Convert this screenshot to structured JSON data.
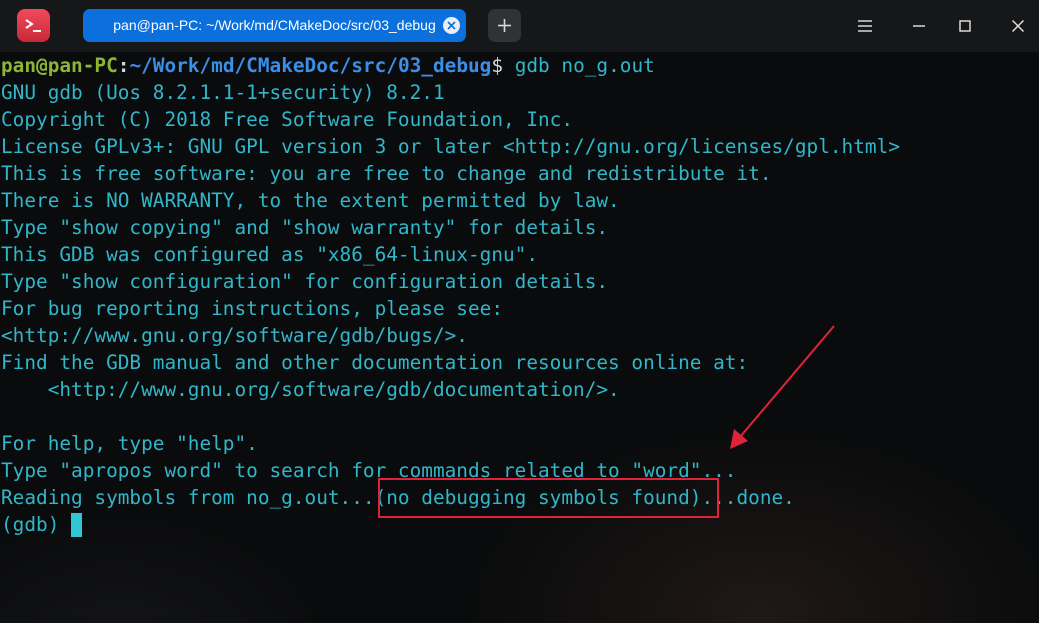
{
  "window": {
    "tab_title": "pan@pan-PC: ~/Work/md/CMakeDoc/src/03_debug",
    "icons": {
      "app": "terminal-app-icon",
      "tab_close": "close-icon",
      "new_tab": "plus-icon",
      "menu": "hamburger-menu-icon",
      "minimize": "minimize-icon",
      "maximize": "maximize-icon",
      "close": "close-icon"
    },
    "colors": {
      "tab_active": "#0b6fdc",
      "app_icon": "#e33b4c",
      "highlight": "#e0233a"
    }
  },
  "terminal": {
    "prompt": {
      "user_host": "pan@pan-PC",
      "separator": ":",
      "path": "~/Work/md/CMakeDoc/src/03_debug",
      "dollar": "$",
      "command": " gdb no_g.out"
    },
    "lines": [
      "GNU gdb (Uos 8.2.1.1-1+security) 8.2.1",
      "Copyright (C) 2018 Free Software Foundation, Inc.",
      "License GPLv3+: GNU GPL version 3 or later <http://gnu.org/licenses/gpl.html>",
      "This is free software: you are free to change and redistribute it.",
      "There is NO WARRANTY, to the extent permitted by law.",
      "Type \"show copying\" and \"show warranty\" for details.",
      "This GDB was configured as \"x86_64-linux-gnu\".",
      "Type \"show configuration\" for configuration details.",
      "For bug reporting instructions, please see:",
      "<http://www.gnu.org/software/gdb/bugs/>.",
      "Find the GDB manual and other documentation resources online at:",
      "    <http://www.gnu.org/software/gdb/documentation/>.",
      "",
      "For help, type \"help\".",
      "Type \"apropos word\" to search for commands related to \"word\"...",
      "Reading symbols from no_g.out...(no debugging symbols found)...done."
    ],
    "gdb_prompt": "(gdb) ",
    "colors": {
      "output": "#32b6c9",
      "user_host": "#8cb634",
      "path": "#3c8ee6",
      "cursor": "#31c5d6"
    }
  }
}
